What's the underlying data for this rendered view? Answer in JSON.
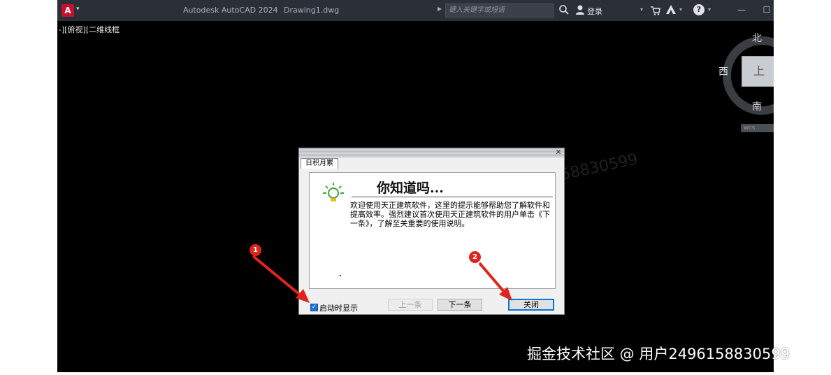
{
  "titlebar": {
    "logo_letter": "A",
    "app_title": "Autodesk AutoCAD 2024",
    "file_title": "Drawing1.dwg",
    "search_placeholder": "键入关键字或短语",
    "login_label": "登录"
  },
  "viewport": {
    "label": "-][俯视][二维线框"
  },
  "viewcube": {
    "north": "北",
    "west": "西",
    "south": "南",
    "top_face": "上",
    "wcs_label": "WCS"
  },
  "dialog": {
    "tab_label": "日积月累",
    "heading": "你知道吗...",
    "body": "欢迎使用天正建筑软件，这里的提示能够帮助您了解软件和提高效率。强烈建议首次使用天正建筑软件的用户单击《下一条》，了解至关重要的使用说明。",
    "startup_checkbox_label": "启动时显示",
    "startup_checked": true,
    "prev_button": "上一条",
    "next_button": "下一条",
    "close_button": "关闭"
  },
  "annotations": {
    "marker_1": "1",
    "marker_2": "2",
    "color": "#e0231b"
  },
  "watermark": "掘金技术社区 @ 用户2496158830599",
  "colors": {
    "canvas": "#000000",
    "titlebar": "#2b2f38",
    "logo": "#c8102e"
  }
}
